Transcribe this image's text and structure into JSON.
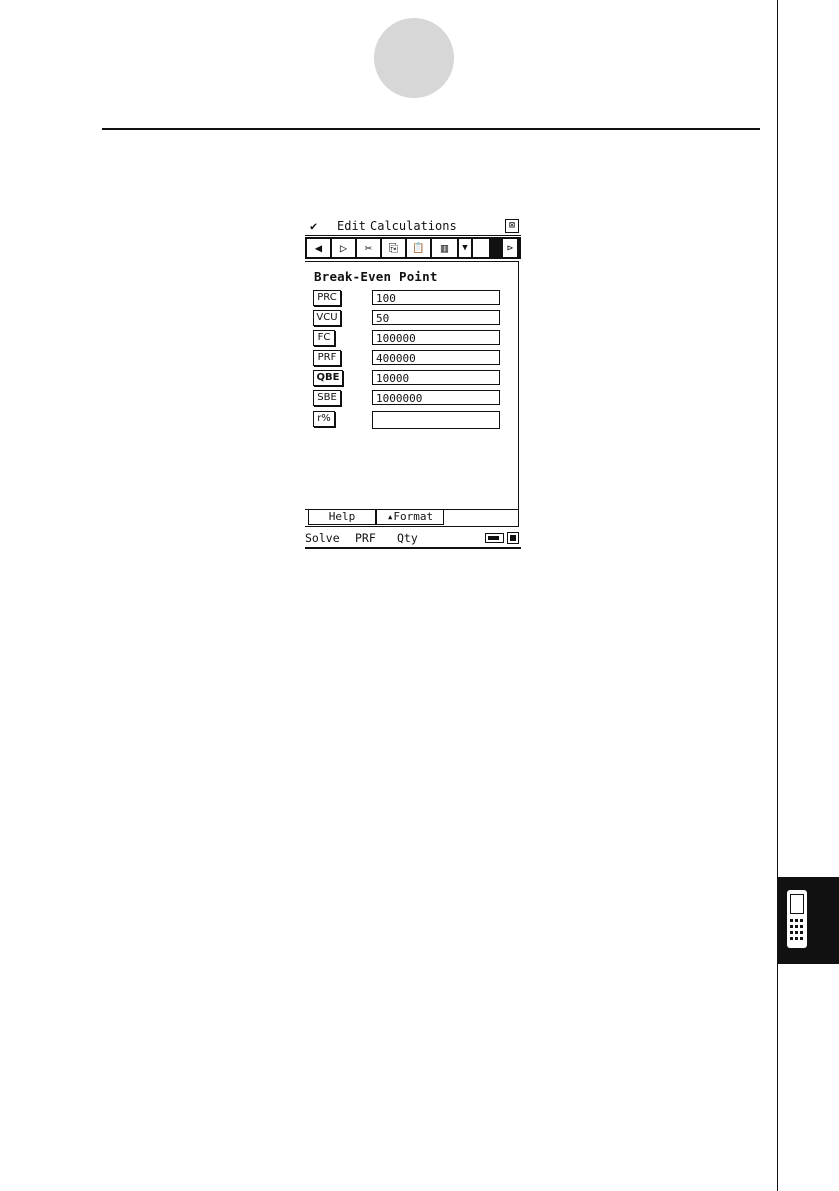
{
  "app": {
    "menu_icon": "✔",
    "menu_edit": "Edit",
    "menu_calc": "Calculations",
    "close_glyph": "⊠"
  },
  "toolbar": [
    {
      "name": "left-arrow-icon",
      "glyph": "◀"
    },
    {
      "name": "right-arrow-icon",
      "glyph": "▷"
    },
    {
      "name": "cut-icon",
      "glyph": "✂"
    },
    {
      "name": "copy-icon",
      "glyph": "⎘"
    },
    {
      "name": "paste-icon",
      "glyph": "📋"
    },
    {
      "name": "table-icon",
      "glyph": "▥"
    },
    {
      "name": "dropdown-icon",
      "glyph": "▼"
    },
    {
      "name": "scroll-right-icon",
      "glyph": "⊳"
    }
  ],
  "form": {
    "title": "Break-Even Point",
    "rows": [
      {
        "label": "PRC",
        "value": "100"
      },
      {
        "label": "VCU",
        "value": "50"
      },
      {
        "label": "FC",
        "value": "100000"
      },
      {
        "label": "PRF",
        "value": "400000"
      },
      {
        "label": "QBE",
        "value": "10000"
      },
      {
        "label": "SBE",
        "value": "1000000"
      },
      {
        "label": "r%",
        "value": ""
      }
    ]
  },
  "tabs": {
    "help": "Help",
    "format": "▴Format"
  },
  "status": {
    "solve": "Solve",
    "prf": "PRF",
    "qty": "Qty"
  }
}
